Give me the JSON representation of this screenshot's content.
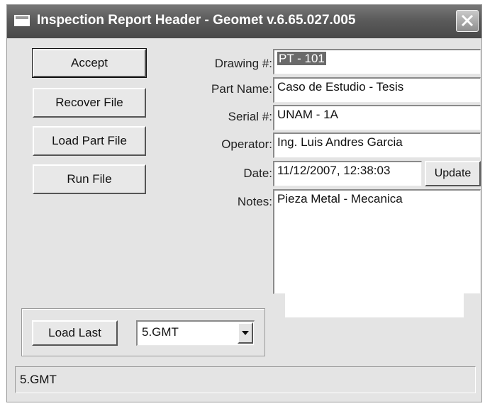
{
  "window": {
    "title": "Inspection Report Header - Geomet v.6.65.027.005"
  },
  "buttons": {
    "accept": "Accept",
    "recover_file": "Recover File",
    "load_part_file": "Load Part File",
    "run_file": "Run File",
    "update": "Update",
    "load_last": "Load Last"
  },
  "form": {
    "drawing": {
      "label": "Drawing #:",
      "value": "PT  -  101"
    },
    "part_name": {
      "label": "Part Name:",
      "value": "Caso de Estudio  -  Tesis"
    },
    "serial": {
      "label": "Serial #:",
      "value": "UNAM - 1A"
    },
    "operator": {
      "label": "Operator:",
      "value": "Ing. Luis Andres Garcia"
    },
    "date": {
      "label": "Date:",
      "value": "11/12/2007, 12:38:03"
    },
    "notes": {
      "label": "Notes:",
      "value": "Pieza Metal - Mecanica"
    }
  },
  "load_last_combo": {
    "selected": "5.GMT"
  },
  "status_bar": {
    "text": "5.GMT"
  },
  "icons": {
    "window": "window-icon",
    "close": "close-icon",
    "dropdown": "chevron-down-icon"
  },
  "colors": {
    "titlebar": "#5b5b5b",
    "window_bg": "#e4e4e4",
    "selection": "#6a6a6a"
  }
}
